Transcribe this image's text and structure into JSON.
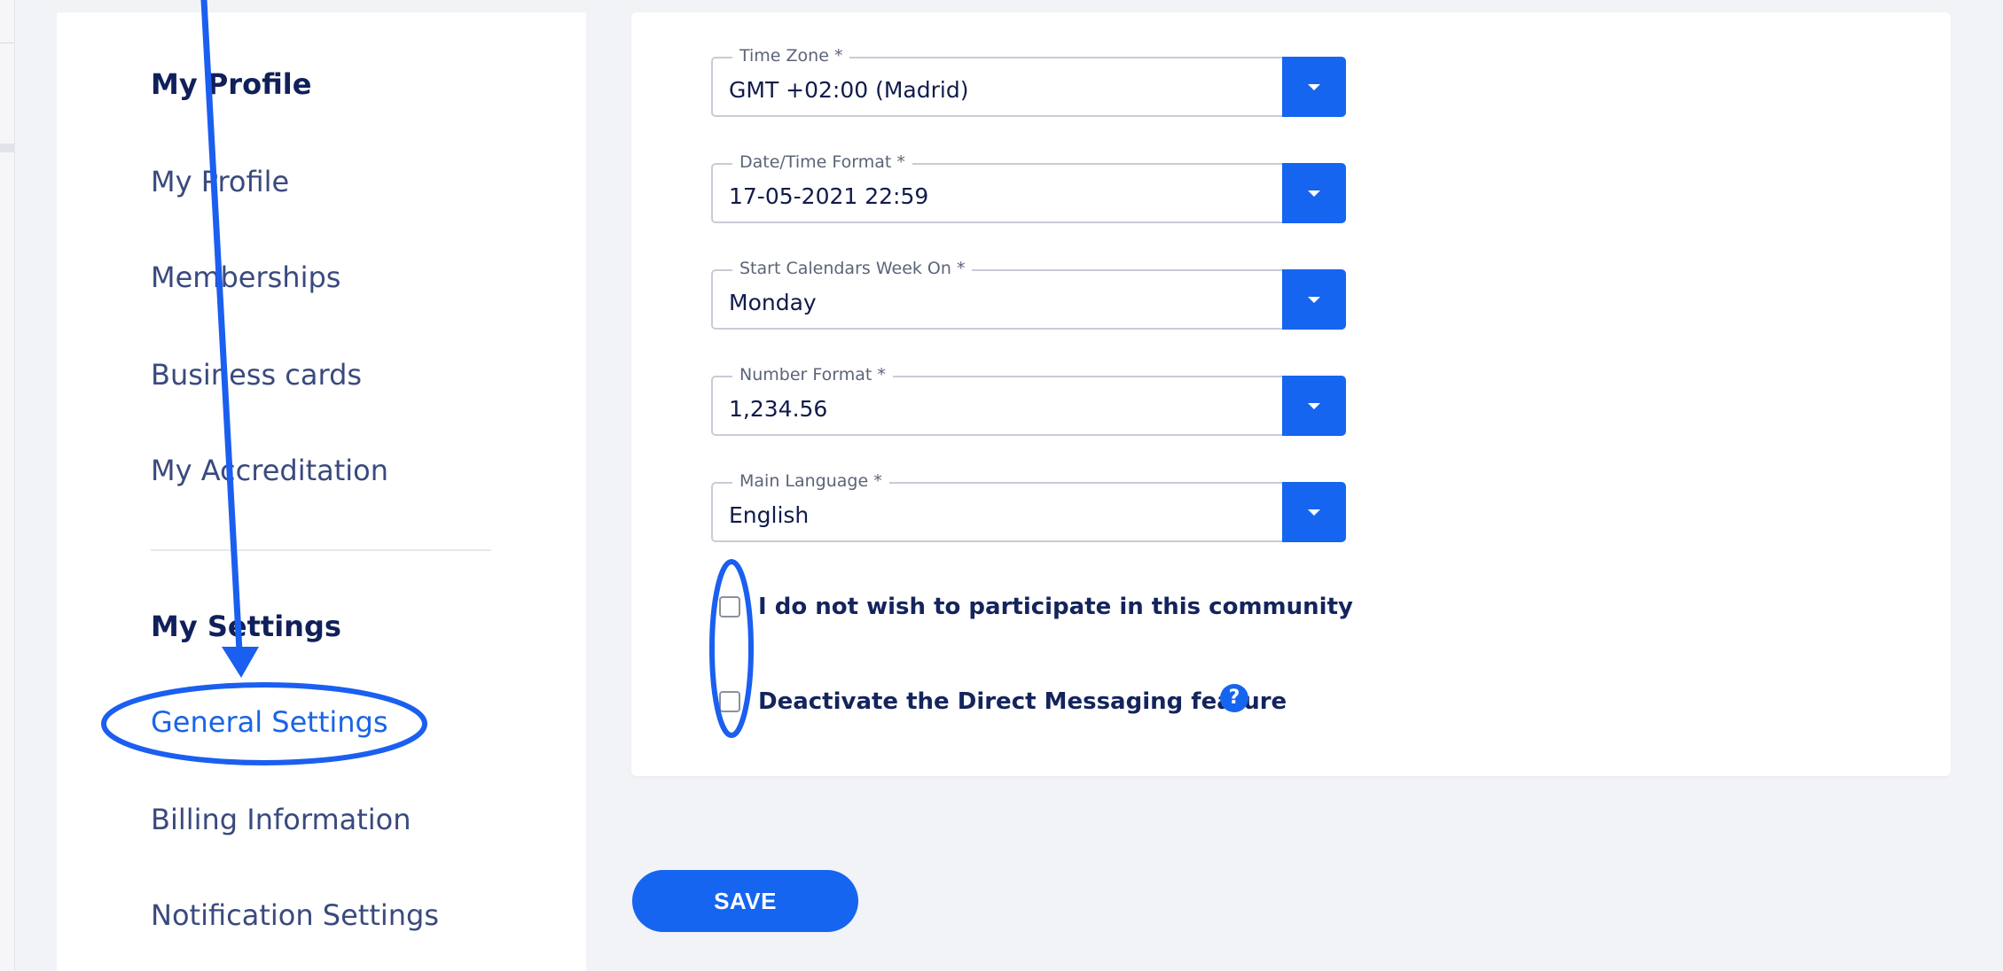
{
  "sidebar": {
    "profile_heading": "My Profile",
    "profile_items": [
      "My Profile",
      "Memberships",
      "Business cards",
      "My Accreditation"
    ],
    "settings_heading": "My Settings",
    "settings_items": [
      "General Settings",
      "Billing Information",
      "Notification Settings"
    ],
    "active_item": "General Settings"
  },
  "form": {
    "fields": [
      {
        "label": "Time Zone *",
        "value": "GMT +02:00 (Madrid)"
      },
      {
        "label": "Date/Time Format *",
        "value": "17-05-2021 22:59"
      },
      {
        "label": "Start Calendars Week On *",
        "value": "Monday"
      },
      {
        "label": "Number Format *",
        "value": "1,234.56"
      },
      {
        "label": "Main Language *",
        "value": "English"
      }
    ],
    "checkboxes": [
      {
        "label": "I do not wish to participate in this community",
        "checked": false
      },
      {
        "label": "Deactivate the Direct Messaging feature",
        "checked": false
      }
    ],
    "help_icon_glyph": "?",
    "save_label": "SAVE"
  },
  "icons": {
    "dropdown": "chevron-down-icon",
    "help": "question-circle-icon"
  },
  "colors": {
    "accent": "#1565f0",
    "annotation": "#1a5ff0",
    "heading": "#10205a",
    "background": "#f2f3f7"
  }
}
